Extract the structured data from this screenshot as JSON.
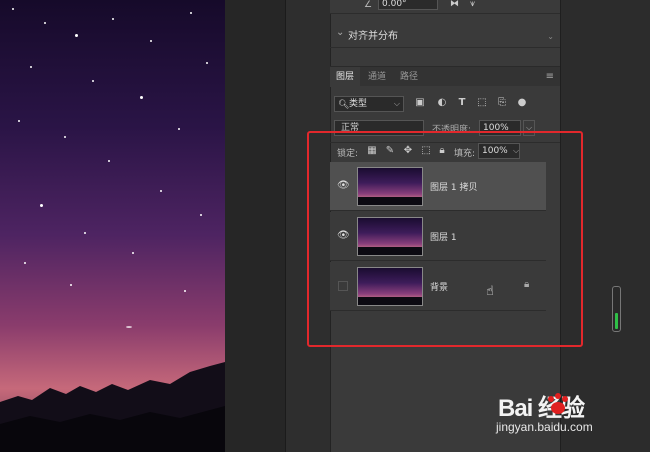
{
  "properties_panel": {
    "rotation_value": "0.00°",
    "align_section_title": "对齐并分布"
  },
  "layers_panel": {
    "tabs": [
      {
        "label": "图层",
        "active": true
      },
      {
        "label": "通道",
        "active": false
      },
      {
        "label": "路径",
        "active": false
      }
    ],
    "filter": {
      "label": "类型"
    },
    "blend_mode": "正常",
    "opacity_label": "不透明度:",
    "opacity_value": "100%",
    "lock_label": "锁定:",
    "fill_label": "填充:",
    "fill_value": "100%",
    "layers": [
      {
        "name": "图层 1 拷贝",
        "visible": true,
        "selected": true,
        "locked": false
      },
      {
        "name": "图层 1",
        "visible": true,
        "selected": false,
        "locked": false
      },
      {
        "name": "背景",
        "visible": false,
        "selected": false,
        "locked": true
      }
    ]
  },
  "watermark": {
    "brand": "Bai 经验",
    "url": "jingyan.baidu.com"
  },
  "colors": {
    "highlight": "#e2282c",
    "panel_bg": "#3a3a3a",
    "selected_row": "#505050",
    "scroll_fill": "#2fbf47"
  }
}
